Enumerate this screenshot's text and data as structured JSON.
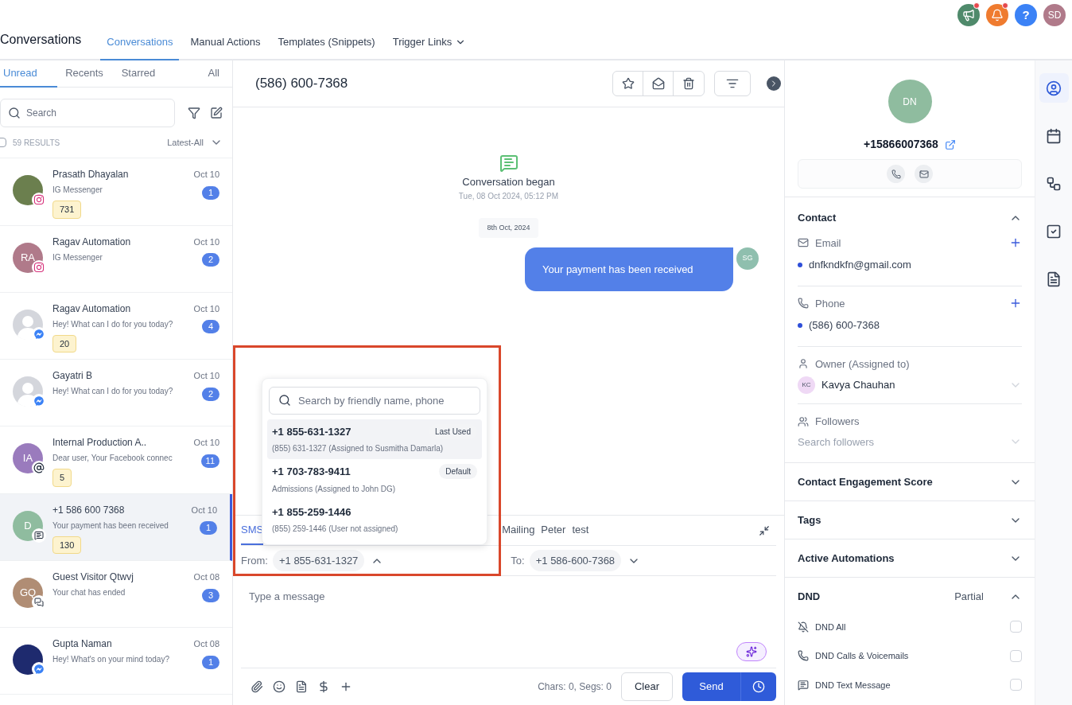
{
  "top_bar": {
    "announcement_dot": true,
    "notification_dot": true,
    "help_label": "?",
    "user_initials": "SD"
  },
  "nav": {
    "title": "Conversations",
    "tabs": [
      {
        "label": "Conversations",
        "selected": true,
        "dropdown": false
      },
      {
        "label": "Manual Actions",
        "selected": false,
        "dropdown": false
      },
      {
        "label": "Templates (Snippets)",
        "selected": false,
        "dropdown": false
      },
      {
        "label": "Trigger Links",
        "selected": false,
        "dropdown": true
      }
    ]
  },
  "inbox": {
    "filter_tabs": [
      {
        "label": "Unread",
        "selected": true
      },
      {
        "label": "Recents",
        "selected": false
      },
      {
        "label": "Starred",
        "selected": false
      },
      {
        "label": "All",
        "selected": false
      }
    ],
    "search": {
      "placeholder": "Search"
    },
    "select_all_checked": false,
    "results": "59 RESULTS",
    "sort": "Latest-All",
    "conversations": [
      {
        "name": "Prasath Dhayalan",
        "preview": "IG Messenger",
        "date": "Oct 10",
        "unread": "1",
        "tag": "731",
        "avatar": {
          "kind": "photo",
          "color": "#6b7f4e"
        },
        "kind": "instagram",
        "selected": false
      },
      {
        "name": "Ragav Automation",
        "preview": "IG Messenger",
        "date": "Oct 10",
        "unread": "2",
        "avatar": {
          "kind": "initials",
          "initials": "RA",
          "color": "#b07a8a"
        },
        "kind": "instagram",
        "selected": false
      },
      {
        "name": "Ragav Automation",
        "preview": "Hey! What can I do for you today?",
        "date": "Oct 10",
        "unread": "4",
        "tag": "20",
        "avatar": {
          "kind": "silhouette",
          "color": "#d4d6dc"
        },
        "kind": "messenger",
        "selected": false
      },
      {
        "name": "Gayatri B",
        "preview": "Hey! What can I do for you today?",
        "date": "Oct 10",
        "unread": "2",
        "avatar": {
          "kind": "silhouette",
          "color": "#d4d6dc"
        },
        "kind": "messenger",
        "selected": false
      },
      {
        "name": "Internal Production A..",
        "preview": "Dear user, Your Facebook connec",
        "date": "Oct 10",
        "unread": "11",
        "tag": "5",
        "avatar": {
          "kind": "initials",
          "initials": "IA",
          "color": "#9a7bbd"
        },
        "kind": "email",
        "selected": false
      },
      {
        "name": "+1 586 600 7368",
        "preview": "Your payment has been received",
        "date": "Oct 10",
        "unread": "1",
        "tag": "130",
        "avatar": {
          "kind": "initials",
          "initials": "D",
          "color": "#8fbc9f"
        },
        "kind": "sms",
        "selected": true
      },
      {
        "name": "Guest Visitor Qtwvj",
        "preview": "Your chat has ended",
        "date": "Oct 08",
        "unread": "3",
        "avatar": {
          "kind": "initials",
          "initials": "GQ",
          "color": "#b08d74"
        },
        "kind": "chat",
        "selected": false
      },
      {
        "name": "Gupta Naman",
        "preview": "Hey! What's on your mind today?",
        "date": "Oct 08",
        "unread": "1",
        "avatar": {
          "kind": "photo",
          "color": "#1e2a6e"
        },
        "kind": "messenger",
        "selected": false
      }
    ]
  },
  "conversation": {
    "title": "(586) 600-7368",
    "event": "Conversation began",
    "event_time": "Tue, 08 Oct 2024, 05:12 PM",
    "date_divider": "8th Oct, 2024",
    "messages": [
      {
        "text": "Your payment has been received",
        "sender_initials": "SG",
        "outgoing": true
      }
    ],
    "composer": {
      "channel_tabs": [
        {
          "label": "SMS",
          "selected": true
        },
        {
          "label": "Mailing",
          "selected": false
        },
        {
          "label": "Peter",
          "selected": false
        },
        {
          "label": "test",
          "selected": false
        }
      ],
      "from_label": "From:",
      "from_value": "+1 855-631-1327",
      "from_open": true,
      "to_label": "To:",
      "to_value": "+1 586-600-7368",
      "placeholder": "Type a message",
      "counter": "Chars: 0, Segs: 0",
      "clear": "Clear",
      "send": "Send",
      "from_dropdown": {
        "search_placeholder": "Search by friendly name, phone",
        "options": [
          {
            "number": "+1 855-631-1327",
            "detail": "(855) 631-1327 (Assigned to Susmitha Damarla)",
            "badge": "Last Used",
            "selected": true
          },
          {
            "number": "+1 703-783-9411",
            "detail": "Admissions (Assigned to John DG)",
            "badge": "Default",
            "selected": false
          },
          {
            "number": "+1 855-259-1446",
            "detail": "(855) 259-1446 (User not assigned)",
            "selected": false
          }
        ]
      }
    }
  },
  "contact": {
    "initials": "DN",
    "phone": "+15866007368",
    "details": {
      "title": "Contact",
      "expanded": true,
      "email_label": "Email",
      "email": "dnfkndkfn@gmail.com",
      "phone_label": "Phone",
      "phone": "(586) 600-7368",
      "owner_label": "Owner (Assigned to)",
      "owner_initials": "KC",
      "owner": "Kavya Chauhan",
      "followers_label": "Followers",
      "followers_placeholder": "Search followers"
    },
    "sections": [
      {
        "title": "Contact Engagement Score",
        "expanded": false
      },
      {
        "title": "Tags",
        "expanded": false
      },
      {
        "title": "Active Automations",
        "expanded": false
      }
    ],
    "dnd": {
      "title": "DND",
      "status": "Partial",
      "expanded": true,
      "options": [
        {
          "label": "DND All",
          "kind": "all",
          "checked": false
        },
        {
          "label": "DND Calls & Voicemails",
          "kind": "calls",
          "checked": false
        },
        {
          "label": "DND Text Message",
          "kind": "text",
          "checked": false
        }
      ]
    }
  },
  "rail": [
    {
      "kind": "contact",
      "selected": true
    },
    {
      "kind": "calendar",
      "selected": false
    },
    {
      "kind": "automation",
      "selected": false
    },
    {
      "kind": "tasks",
      "selected": false
    },
    {
      "kind": "notes",
      "selected": false
    }
  ]
}
